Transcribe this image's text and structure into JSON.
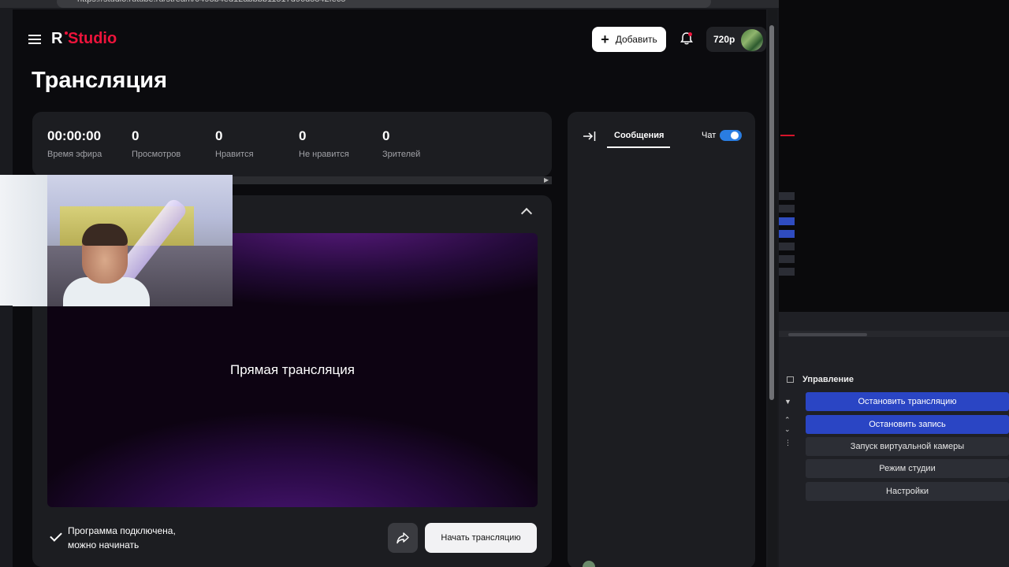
{
  "browser": {
    "url": "https://studio.rutube.ru/stream/0498b4ed12abbbb11517d96d5842fec5"
  },
  "header": {
    "logo_r": "R",
    "logo_studio": "Studio",
    "add_label": "Добавить",
    "quality": "720p"
  },
  "page": {
    "title": "Трансляция"
  },
  "stats": [
    {
      "value": "00:00:00",
      "label": "Время эфира"
    },
    {
      "value": "0",
      "label": "Просмотров"
    },
    {
      "value": "0",
      "label": "Нравится"
    },
    {
      "value": "0",
      "label": "Не нравится"
    },
    {
      "value": "0",
      "label": "Зрителей"
    }
  ],
  "preview": {
    "text": "Прямая трансляция",
    "status_line1": "Программа подключена,",
    "status_line2": "можно начинать",
    "start_label": "Начать трансляцию"
  },
  "chat": {
    "tab_messages": "Сообщения",
    "chat_label": "Чат",
    "chat_enabled": true
  },
  "obs": {
    "controls_title": "Управление",
    "buttons": [
      {
        "label": "Остановить трансляцию",
        "active": true
      },
      {
        "label": "Остановить запись",
        "active": true
      },
      {
        "label": "Запуск виртуальной камеры",
        "active": false
      },
      {
        "label": "Режим студии",
        "active": false
      },
      {
        "label": "Настройки",
        "active": false
      }
    ]
  },
  "colors": {
    "brand_red": "#ed143b",
    "obs_blue": "#2a45c4",
    "toggle_blue": "#2a7de1"
  }
}
